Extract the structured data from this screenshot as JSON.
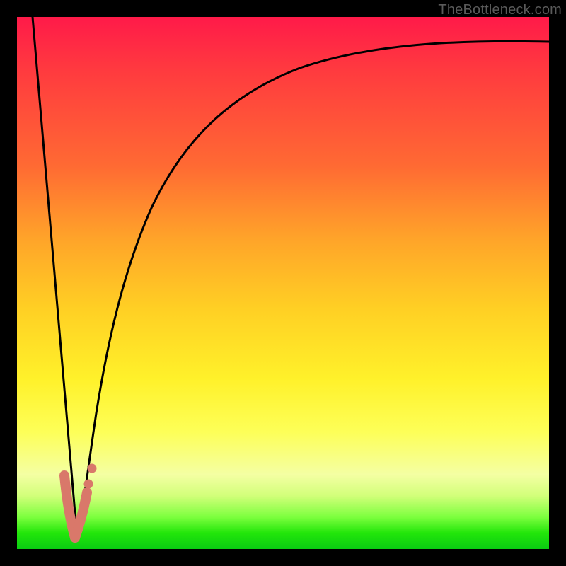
{
  "watermark": "TheBottleneck.com",
  "chart_data": {
    "type": "line",
    "title": "",
    "xlabel": "",
    "ylabel": "",
    "xlim": [
      0,
      100
    ],
    "ylim": [
      0,
      100
    ],
    "grid": false,
    "series": [
      {
        "name": "left-branch",
        "x": [
          3,
          5,
          7,
          9,
          10,
          11
        ],
        "values": [
          100,
          72,
          44,
          16,
          4,
          0
        ]
      },
      {
        "name": "right-branch",
        "x": [
          11,
          12,
          13,
          15,
          18,
          22,
          28,
          36,
          46,
          60,
          78,
          100
        ],
        "values": [
          0,
          6,
          18,
          36,
          52,
          64,
          74,
          81,
          86,
          90,
          93,
          95
        ]
      },
      {
        "name": "marker-cluster",
        "type": "scatter",
        "x": [
          9.5,
          10.0,
          10.5,
          11.0,
          11.5,
          11.5,
          12.0,
          12.7,
          12.5
        ],
        "values": [
          12,
          8,
          5,
          2,
          3,
          6,
          8,
          9,
          13
        ]
      }
    ],
    "colors": {
      "curve": "#000000",
      "marker": "#d9786a"
    }
  }
}
